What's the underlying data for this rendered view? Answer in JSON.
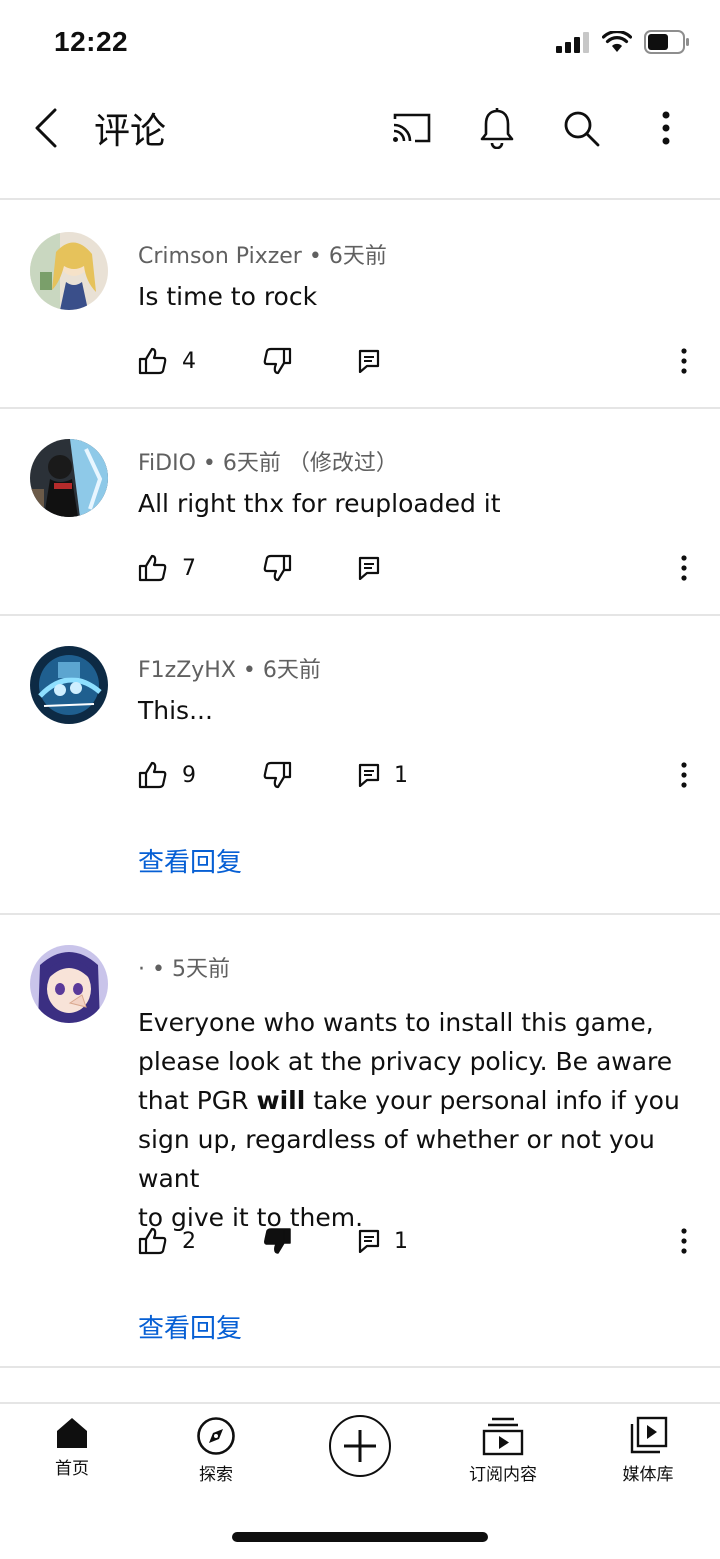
{
  "status_bar": {
    "time": "12:22",
    "icons": [
      "signal-icon",
      "wifi-icon",
      "battery-icon"
    ]
  },
  "header": {
    "title": "评论",
    "icons": [
      "back-icon",
      "cast-icon",
      "bell-icon",
      "search-icon",
      "more-vert-icon"
    ]
  },
  "comments": [
    {
      "author": "Crimson Pixzer",
      "time": "6天前",
      "edited": "",
      "text": "Is time to rock",
      "likes": "4",
      "replies": "",
      "disliked": false
    },
    {
      "author": "FiDIO",
      "time": "6天前",
      "edited": "（修改过）",
      "text": "All right thx for reuploaded it",
      "likes": "7",
      "replies": "",
      "disliked": false
    },
    {
      "author": "F1zZyHX",
      "time": "6天前",
      "edited": "",
      "text": "This...",
      "likes": "9",
      "replies": "1",
      "view_replies": "查看回复",
      "disliked": false
    },
    {
      "author": "·",
      "time": "5天前",
      "edited": "",
      "text_lines": [
        "Everyone who wants to install this game,",
        "please look at the privacy policy.  Be aware",
        [
          "that PGR ",
          "will",
          " take your personal info if you"
        ],
        "sign up, regardless of whether or not you want",
        "to give it to them."
      ],
      "likes": "2",
      "replies": "1",
      "view_replies": "查看回复",
      "disliked": true
    }
  ],
  "bottom_nav": {
    "items": [
      {
        "label": "首页",
        "icon": "home-icon"
      },
      {
        "label": "探索",
        "icon": "explore-icon"
      },
      {
        "label": "",
        "icon": "create-icon"
      },
      {
        "label": "订阅内容",
        "icon": "subscriptions-icon"
      },
      {
        "label": "媒体库",
        "icon": "library-icon"
      }
    ]
  },
  "colors": {
    "link": "#065fd4",
    "text": "#0f0f0f",
    "meta": "#606060",
    "divider": "#e5e5e5"
  }
}
